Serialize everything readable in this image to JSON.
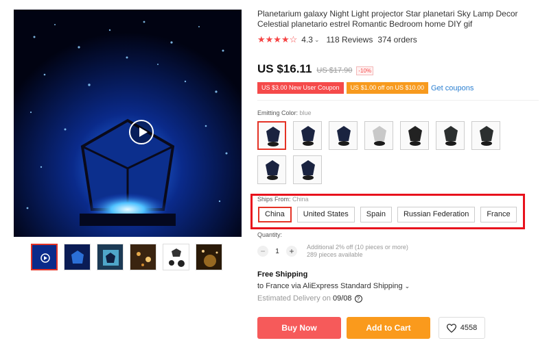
{
  "product": {
    "title": "Planetarium galaxy Night Light projector Star planetari Sky Lamp Decor Celestial planetario estrel Romantic Bedroom home DIY gif",
    "rating": "4.3",
    "rating_stars": 4.5,
    "reviews": "118 Reviews",
    "orders": "374 orders"
  },
  "price": {
    "current": "US $16.11",
    "original": "US $17.90",
    "discount": "-10%"
  },
  "coupons": {
    "new_user": "US $3.00 New User Coupon",
    "off": "US $1.00 off on US $10.00",
    "get_label": "Get coupons"
  },
  "color": {
    "label": "Emitting Color:",
    "selected": "blue",
    "swatch_count": 9
  },
  "ships_from": {
    "label": "Ships From:",
    "selected": "China",
    "options": [
      "China",
      "United States",
      "Spain",
      "Russian Federation",
      "France"
    ]
  },
  "quantity": {
    "label": "Quantity:",
    "value": "1",
    "note": "Additional 2% off (10 pieces or more)",
    "available": "289 pieces available"
  },
  "shipping": {
    "free": "Free Shipping",
    "to": "to France via AliExpress Standard Shipping",
    "delivery_label": "Estimated Delivery on",
    "delivery_date": "09/08"
  },
  "actions": {
    "buy_now": "Buy Now",
    "add_to_cart": "Add to Cart",
    "wishlist_count": "4558"
  },
  "colors": {
    "accent_red": "#f65a5a",
    "accent_orange": "#fa9a1c",
    "highlight_box": "#e8111c",
    "link": "#2a7fd1"
  }
}
